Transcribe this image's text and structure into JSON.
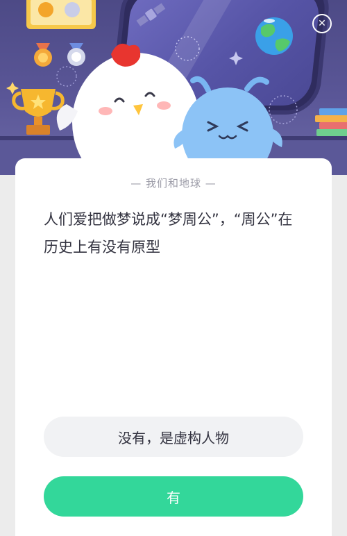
{
  "quiz": {
    "section_label": "— 我们和地球 —",
    "question": "人们爱把做梦说成“梦周公”，“周公”在历史上有没有原型",
    "options": [
      {
        "label": "没有，是虚构人物"
      },
      {
        "label": "有"
      }
    ]
  },
  "header": {
    "close_symbol": "✕"
  },
  "colors": {
    "header_bg": "#5a5697",
    "card_bg": "#ffffff",
    "option_neutral_bg": "#f1f2f4",
    "option_accent_bg": "#33d79a",
    "text_primary": "#333340",
    "text_muted": "#9a9aa6"
  }
}
